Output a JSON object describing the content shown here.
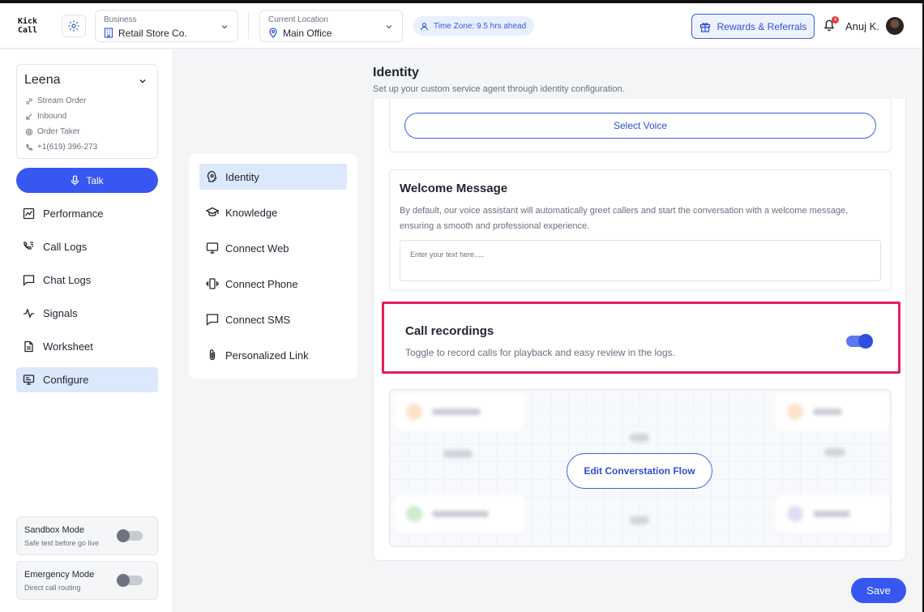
{
  "topbar": {
    "logo": "Kick Call",
    "business": {
      "caption": "Business",
      "value": "Retail Store Co."
    },
    "location": {
      "caption": "Current Location",
      "value": "Main Office"
    },
    "timezone": "Time Zone: 9.5 hrs ahead",
    "rewards_label": "Rewards & Referrals",
    "notifications_count": "4",
    "user_name": "Anuj K."
  },
  "agent": {
    "name": "Leena",
    "details": [
      "Stream Order",
      "Inbound",
      "Order Taker",
      "+1(619) 396-273"
    ]
  },
  "sidebar": {
    "talk_label": "Talk",
    "nav": [
      {
        "label": "Performance",
        "icon": "chart-icon"
      },
      {
        "label": "Call Logs",
        "icon": "phone-list-icon"
      },
      {
        "label": "Chat Logs",
        "icon": "chat-icon"
      },
      {
        "label": "Signals",
        "icon": "pulse-icon"
      },
      {
        "label": "Worksheet",
        "icon": "document-icon"
      },
      {
        "label": "Configure",
        "icon": "monitor-icon",
        "active": true
      }
    ],
    "sandbox": {
      "title": "Sandbox Mode",
      "subtitle": "Safe test before go live",
      "enabled": false
    },
    "emergency": {
      "title": "Emergency Mode",
      "subtitle": "Direct call routing",
      "enabled": false
    }
  },
  "settings_menu": [
    {
      "label": "Identity",
      "icon": "identity-icon",
      "active": true
    },
    {
      "label": "Knowledge",
      "icon": "graduation-cap-icon"
    },
    {
      "label": "Connect Web",
      "icon": "monitor-icon"
    },
    {
      "label": "Connect Phone",
      "icon": "vibrating-phone-icon"
    },
    {
      "label": "Connect SMS",
      "icon": "message-icon"
    },
    {
      "label": "Personalized Link",
      "icon": "paperclip-icon"
    }
  ],
  "page": {
    "title": "Identity",
    "subtitle": "Set up your custom service agent through identity configuration."
  },
  "voice": {
    "select_label": "Select Voice"
  },
  "welcome": {
    "title": "Welcome Message",
    "description": "By default, our voice assistant will automatically greet callers and start the conversation with a welcome message, ensuring a smooth and professional experience.",
    "placeholder": "Enter your text here.....",
    "value": ""
  },
  "recordings": {
    "title": "Call recordings",
    "description": "Toggle to record calls for playback and easy review in the logs.",
    "enabled": true
  },
  "flow": {
    "edit_label": "Edit Converstation Flow"
  },
  "actions": {
    "save_label": "Save"
  },
  "colors": {
    "accent": "#3857f0",
    "highlight": "#e81c5a",
    "active_bg": "#dce8fb"
  }
}
